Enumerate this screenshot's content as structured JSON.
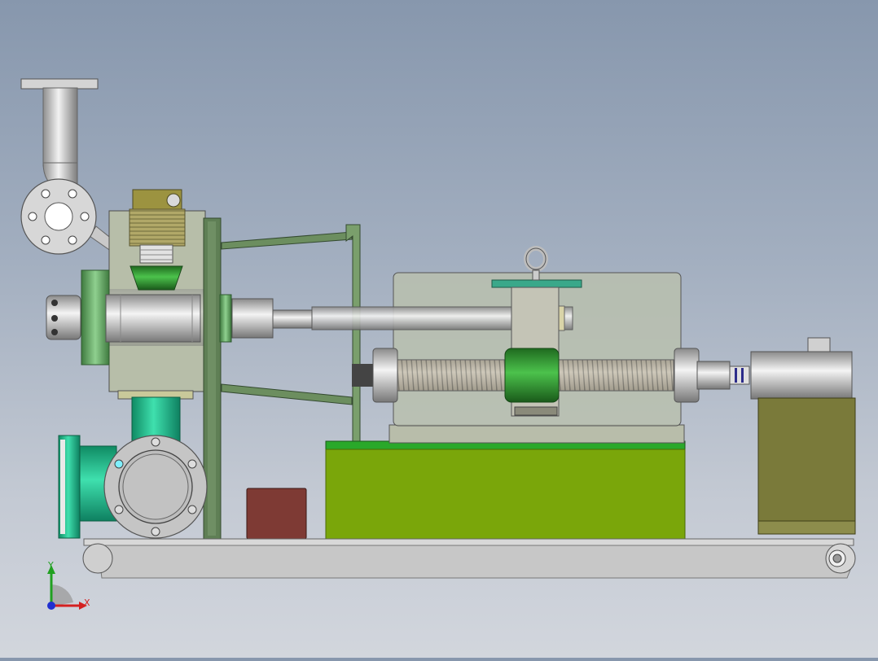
{
  "viewport": {
    "background_top": "#8797ad",
    "background_bottom": "#d2d6dd"
  },
  "triad": {
    "x_label": "X",
    "y_label": "Y",
    "x_color": "#d42020",
    "y_color": "#20a020",
    "z_color": "#2030d0"
  },
  "colors": {
    "frame_green": "#5f7f55",
    "base_green": "#7aa60a",
    "teal_pipe": "#1fb889",
    "motor_olive": "#7a7a3a",
    "brown_box": "#7e3a34",
    "steel": "#c8c8c8",
    "housing_glass": "#b9bfae"
  }
}
